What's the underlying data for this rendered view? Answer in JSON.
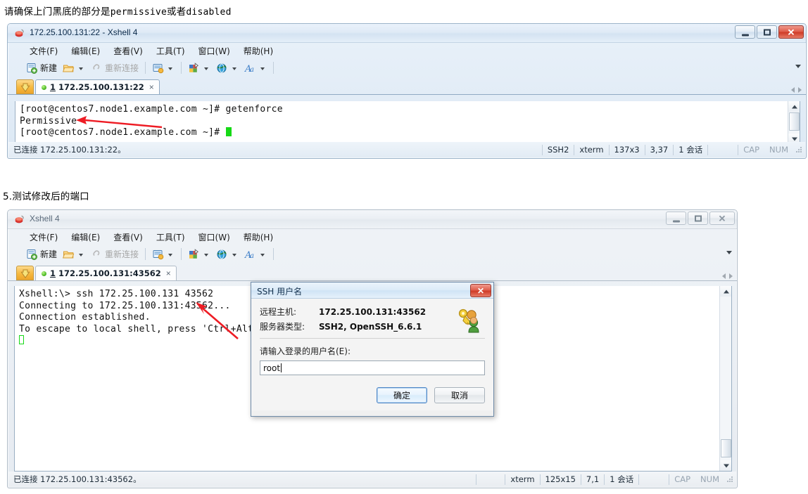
{
  "annotations": {
    "note_top": "请确保上门黑底的部分是",
    "note_top_mono1": "permissive",
    "note_top_mid": "或者",
    "note_top_mono2": "disabled",
    "step_label": "5.测试修改后的端口",
    "arrow_color": "#ee1c24"
  },
  "window1": {
    "title": "172.25.100.131:22 - Xshell 4",
    "controls": {
      "minimize": "—",
      "maximize": "□",
      "close": "✕"
    },
    "menu": [
      "文件(F)",
      "编辑(E)",
      "查看(V)",
      "工具(T)",
      "窗口(W)",
      "帮助(H)"
    ],
    "toolbar": {
      "new_label": "新建",
      "reconnect_label": "重新连接"
    },
    "tab": {
      "index": "1",
      "label": "172.25.100.131:22",
      "close": "×"
    },
    "terminal": {
      "line1": "[root@centos7.node1.example.com ~]# getenforce",
      "line2": "Permissive",
      "line3": "[root@centos7.node1.example.com ~]# "
    },
    "status": {
      "connection": "已连接 172.25.100.131:22。",
      "protocol": "SSH2",
      "term_type": "xterm",
      "size": "137x3",
      "cursor": "3,37",
      "sessions": "1 会话",
      "cap": "CAP",
      "num": "NUM"
    }
  },
  "window2": {
    "title": "Xshell 4",
    "controls": {
      "minimize": "—",
      "maximize": "□",
      "close": "✕"
    },
    "menu": [
      "文件(F)",
      "编辑(E)",
      "查看(V)",
      "工具(T)",
      "窗口(W)",
      "帮助(H)"
    ],
    "toolbar": {
      "new_label": "新建",
      "reconnect_label": "重新连接"
    },
    "tab": {
      "index": "1",
      "label": "172.25.100.131:43562",
      "close": "×"
    },
    "terminal": {
      "line1": "Xshell:\\> ssh 172.25.100.131 43562",
      "line2": "",
      "line3": "",
      "line4": "Connecting to 172.25.100.131:43562...",
      "line5": "Connection established.",
      "line6": "To escape to local shell, press 'Ctrl+Alt+"
    },
    "status": {
      "connection": "已连接 172.25.100.131:43562。",
      "term_type": "xterm",
      "size": "125x15",
      "cursor": "7,1",
      "sessions": "1 会话",
      "cap": "CAP",
      "num": "NUM"
    },
    "dialog": {
      "title": "SSH 用户名",
      "close": "✕",
      "host_key": "远程主机:",
      "host_value": "172.25.100.131:43562",
      "server_key": "服务器类型:",
      "server_value": "SSH2, OpenSSH_6.6.1",
      "prompt": "请输入登录的用户名(E):",
      "input_value": "root",
      "ok": "确定",
      "cancel": "取消"
    }
  }
}
